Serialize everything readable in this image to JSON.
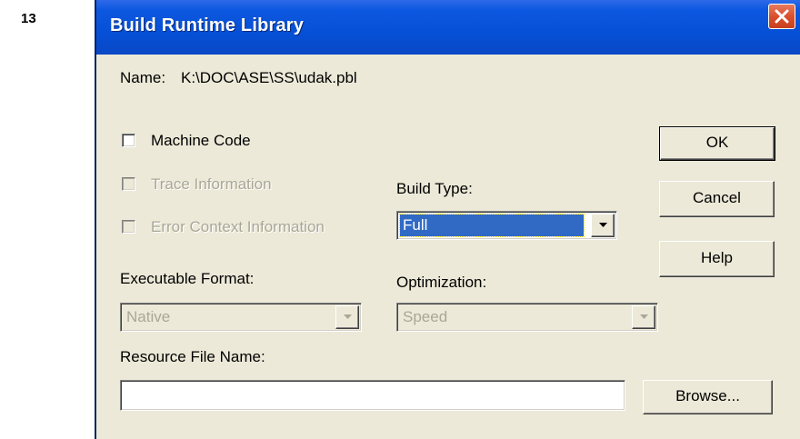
{
  "page_number": "13",
  "dialog": {
    "title": "Build Runtime Library",
    "close_icon": "close-icon"
  },
  "name_row": {
    "label": "Name:",
    "value": "K:\\DOC\\ASE\\SS\\udak.pbl"
  },
  "checkboxes": {
    "machine_code": {
      "label": "Machine Code",
      "checked": false,
      "enabled": true
    },
    "trace_information": {
      "label": "Trace Information",
      "checked": false,
      "enabled": false
    },
    "error_context_information": {
      "label": "Error Context Information",
      "checked": false,
      "enabled": false
    }
  },
  "build_type": {
    "label": "Build Type:",
    "selected": "Full",
    "enabled": true
  },
  "executable_format": {
    "label": "Executable Format:",
    "selected": "Native",
    "enabled": false
  },
  "optimization": {
    "label": "Optimization:",
    "selected": "Speed",
    "enabled": false
  },
  "resource_file": {
    "label": "Resource File Name:",
    "value": "",
    "browse_label": "Browse..."
  },
  "buttons": {
    "ok_label": "OK",
    "cancel_label": "Cancel",
    "help_label": "Help"
  },
  "colors": {
    "titlebar": "#0550d6",
    "dialog_bg": "#ece9d8",
    "selection": "#316ac5",
    "close_button": "#d9502e",
    "disabled_text": "#a9a796"
  }
}
